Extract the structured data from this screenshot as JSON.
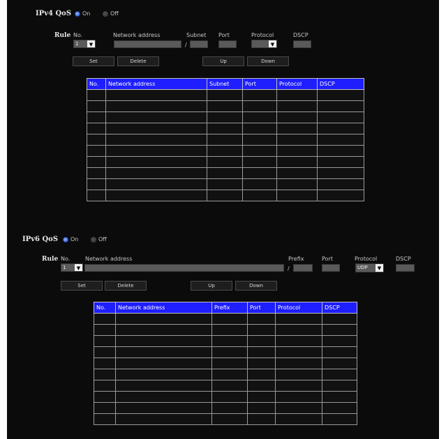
{
  "ipv4": {
    "title": "IPv4 QoS",
    "radio_on": "On",
    "radio_off": "Off",
    "rule_label": "Rule",
    "col_no": "No.",
    "col_network": "Network address",
    "col_subnet": "Subnet",
    "col_port": "Port",
    "col_protocol": "Protocol",
    "col_dscp": "DSCP",
    "no_value": "1",
    "protocol_value": "",
    "slash": "/",
    "btn_set": "Set",
    "btn_delete": "Delete",
    "btn_up": "Up",
    "btn_down": "Down",
    "headers": [
      "No.",
      "Network address",
      "Subnet",
      "Port",
      "Protocol",
      "DSCP"
    ],
    "rows": 10
  },
  "ipv6": {
    "title": "IPv6 QoS",
    "radio_on": "On",
    "radio_off": "Off",
    "rule_label": "Rule",
    "col_no": "No.",
    "col_network": "Network address",
    "col_prefix": "Prefix",
    "col_port": "Port",
    "col_protocol": "Protocol",
    "col_dscp": "DSCP",
    "no_value": "1",
    "protocol_value": "UDP",
    "slash": "/",
    "btn_set": "Set",
    "btn_delete": "Delete",
    "btn_up": "Up",
    "btn_down": "Down",
    "headers": [
      "No.",
      "Network address",
      "Prefix",
      "Port",
      "Protocol",
      "DSCP"
    ],
    "rows": 10
  },
  "colors": {
    "panel_bg": "#0b0b0b",
    "table_header": "#1e1eff",
    "radio_on": "#2b5fd0",
    "field": "#5a5a5a"
  },
  "icons": {
    "select_arrow": "chevron-down-icon"
  }
}
